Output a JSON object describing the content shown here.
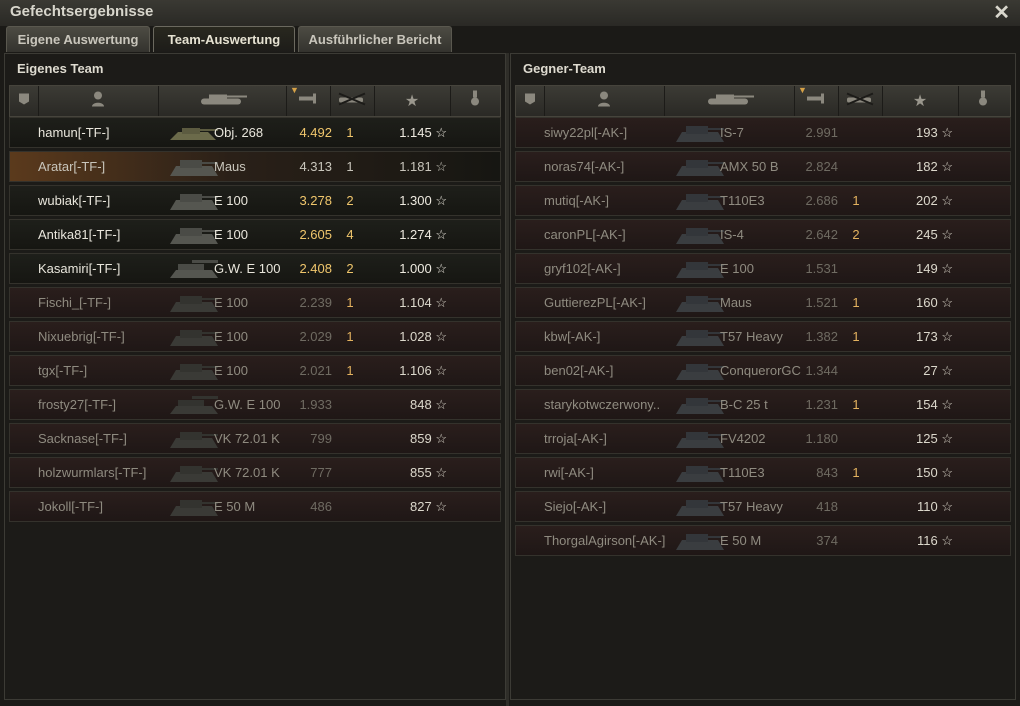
{
  "window": {
    "title": "Gefechtsergebnisse",
    "close_icon": "close-icon"
  },
  "tabs": [
    {
      "label": "Eigene Auswertung",
      "active": false
    },
    {
      "label": "Team-Auswertung",
      "active": true
    },
    {
      "label": "Ausführlicher Bericht",
      "active": false
    }
  ],
  "own_team": {
    "title": "Eigenes Team",
    "players": [
      {
        "name": "hamun[-TF-]",
        "tank": "Obj. 268",
        "damage": "4.492",
        "kills": "1",
        "xp": "1.145 ☆",
        "alive": true
      },
      {
        "name": "Aratar[-TF-]",
        "tank": "Maus",
        "damage": "4.313",
        "kills": "1",
        "xp": "1.181 ☆",
        "alive": true,
        "self": true
      },
      {
        "name": "wubiak[-TF-]",
        "tank": "E 100",
        "damage": "3.278",
        "kills": "2",
        "xp": "1.300 ☆",
        "alive": true
      },
      {
        "name": "Antika81[-TF-]",
        "tank": "E 100",
        "damage": "2.605",
        "kills": "4",
        "xp": "1.274 ☆",
        "alive": true
      },
      {
        "name": "Kasamiri[-TF-]",
        "tank": "G.W. E 100",
        "damage": "2.408",
        "kills": "2",
        "xp": "1.000 ☆",
        "alive": true
      },
      {
        "name": "Fischi_[-TF-]",
        "tank": "E 100",
        "damage": "2.239",
        "kills": "1",
        "xp": "1.104 ☆",
        "alive": false
      },
      {
        "name": "Nixuebrig[-TF-]",
        "tank": "E 100",
        "damage": "2.029",
        "kills": "1",
        "xp": "1.028 ☆",
        "alive": false
      },
      {
        "name": "tgx[-TF-]",
        "tank": "E 100",
        "damage": "2.021",
        "kills": "1",
        "xp": "1.106 ☆",
        "alive": false
      },
      {
        "name": "frosty27[-TF-]",
        "tank": "G.W. E 100",
        "damage": "1.933",
        "kills": "",
        "xp": "848 ☆",
        "alive": false
      },
      {
        "name": "Sacknase[-TF-]",
        "tank": "VK 72.01 K",
        "damage": "799",
        "kills": "",
        "xp": "859 ☆",
        "alive": false
      },
      {
        "name": "holzwurmlars[-TF-]",
        "tank": "VK 72.01 K",
        "damage": "777",
        "kills": "",
        "xp": "855 ☆",
        "alive": false
      },
      {
        "name": "Jokoll[-TF-]",
        "tank": "E 50 M",
        "damage": "486",
        "kills": "",
        "xp": "827 ☆",
        "alive": false
      }
    ]
  },
  "enemy_team": {
    "title": "Gegner-Team",
    "players": [
      {
        "name": "siwy22pl[-AK-]",
        "tank": "IS-7",
        "damage": "2.991",
        "kills": "",
        "xp": "193 ☆",
        "alive": false
      },
      {
        "name": "noras74[-AK-]",
        "tank": "AMX 50 B",
        "damage": "2.824",
        "kills": "",
        "xp": "182 ☆",
        "alive": false
      },
      {
        "name": "mutiq[-AK-]",
        "tank": "T110E3",
        "damage": "2.686",
        "kills": "1",
        "xp": "202 ☆",
        "alive": false
      },
      {
        "name": "caronPL[-AK-]",
        "tank": "IS-4",
        "damage": "2.642",
        "kills": "2",
        "xp": "245 ☆",
        "alive": false
      },
      {
        "name": "gryf102[-AK-]",
        "tank": "E 100",
        "damage": "1.531",
        "kills": "",
        "xp": "149 ☆",
        "alive": false
      },
      {
        "name": "GuttierezPL[-AK-]",
        "tank": "Maus",
        "damage": "1.521",
        "kills": "1",
        "xp": "160 ☆",
        "alive": false
      },
      {
        "name": "kbw[-AK-]",
        "tank": "T57 Heavy",
        "damage": "1.382",
        "kills": "1",
        "xp": "173 ☆",
        "alive": false
      },
      {
        "name": "ben02[-AK-]",
        "tank": "ConquerorGC",
        "damage": "1.344",
        "kills": "",
        "xp": "27 ☆",
        "alive": false
      },
      {
        "name": "starykotwczerwony..",
        "tank": "B-C 25 t",
        "damage": "1.231",
        "kills": "1",
        "xp": "154 ☆",
        "alive": false
      },
      {
        "name": "trroja[-AK-]",
        "tank": "FV4202",
        "damage": "1.180",
        "kills": "",
        "xp": "125 ☆",
        "alive": false
      },
      {
        "name": "rwi[-AK-]",
        "tank": "T110E3",
        "damage": "843",
        "kills": "1",
        "xp": "150 ☆",
        "alive": false
      },
      {
        "name": "Siejo[-AK-]",
        "tank": "T57 Heavy",
        "damage": "418",
        "kills": "",
        "xp": "110 ☆",
        "alive": false
      },
      {
        "name": "ThorgalAgirson[-AK-]",
        "tank": "E 50 M",
        "damage": "374",
        "kills": "",
        "xp": "116 ☆",
        "alive": false
      }
    ]
  },
  "columns": [
    {
      "icon": "squad-icon"
    },
    {
      "icon": "player-icon"
    },
    {
      "icon": "tank-icon"
    },
    {
      "icon": "damage-icon"
    },
    {
      "icon": "frags-icon"
    },
    {
      "icon": "experience-star-icon"
    },
    {
      "icon": "medal-icon"
    }
  ]
}
